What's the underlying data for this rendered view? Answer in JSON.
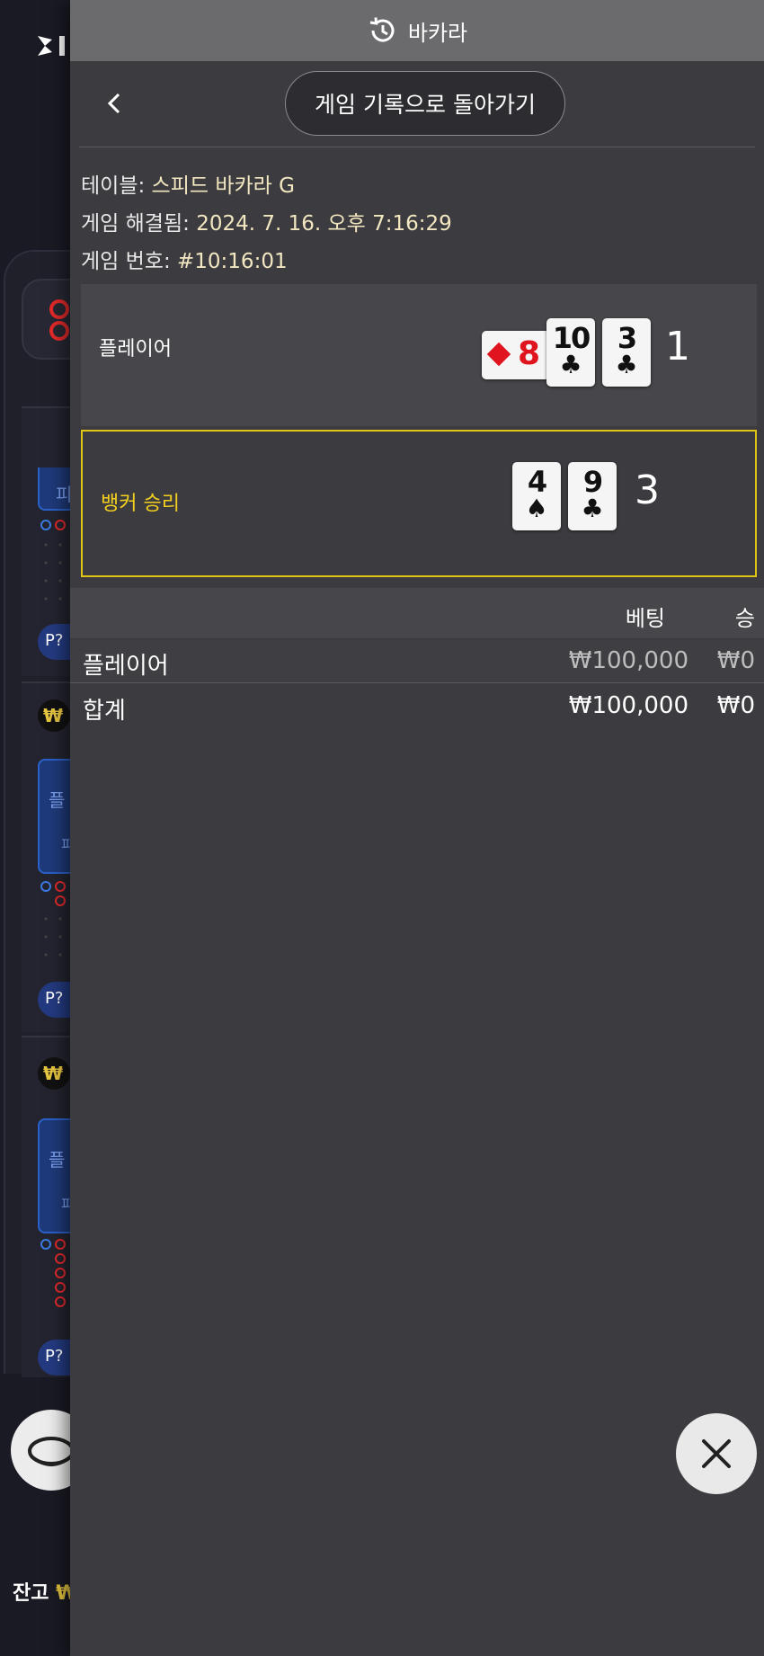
{
  "header": {
    "title": "바카라",
    "history_icon": "history-icon"
  },
  "nav": {
    "back_icon": "chevron-left-icon",
    "return_label": "게임 기록으로 돌아가기"
  },
  "game_info": {
    "table_label": "테이블:",
    "table_value": "스피드 바카라 G",
    "resolved_label": "게임 해결됨:",
    "resolved_value": "2024. 7. 16. 오후 7:16:29",
    "number_label": "게임 번호:",
    "number_value": "#10:16:01"
  },
  "hands": {
    "player": {
      "label": "플레이어",
      "score": "1",
      "side_card": {
        "rank": "8",
        "suit": "♦"
      },
      "cards": [
        {
          "rank": "10",
          "suit": "♣"
        },
        {
          "rank": "3",
          "suit": "♣"
        }
      ]
    },
    "banker": {
      "label": "뱅커 승리",
      "score": "3",
      "cards": [
        {
          "rank": "4",
          "suit": "♠"
        },
        {
          "rank": "9",
          "suit": "♣"
        }
      ]
    }
  },
  "bets": {
    "col_bet": "베팅",
    "col_win": "승",
    "rows": [
      {
        "name": "플레이어",
        "amount": "₩100,000",
        "win": "₩0"
      }
    ],
    "total": {
      "name": "합계",
      "amount": "₩100,000",
      "win": "₩0"
    }
  },
  "close_icon": "close-icon",
  "background": {
    "pill_label": "P?",
    "won_symbol": "₩",
    "blue_text_1": "플",
    "blue_text_2": "피",
    "balance_label": "잔고",
    "balance_symbol": "₩"
  },
  "colors": {
    "accent_yellow": "#e0c515",
    "banker_label": "#f3cf1e",
    "panel": "#3c3c40",
    "header": "#6b6b6e",
    "red_suit": "#e0141e"
  }
}
